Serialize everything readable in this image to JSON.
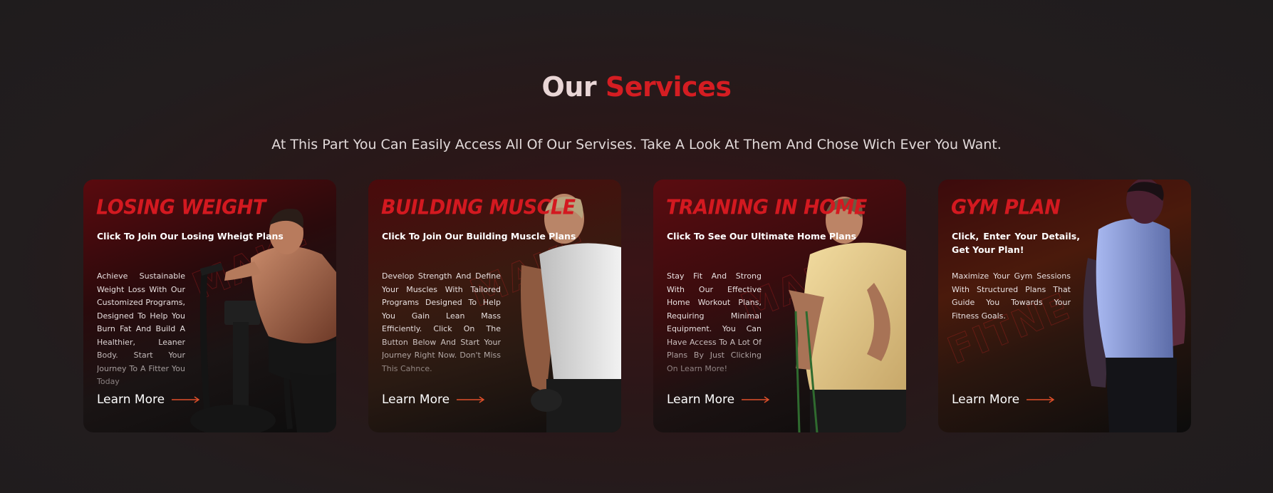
{
  "section": {
    "title_part1": "Our",
    "title_part2": "Services",
    "subtitle": "At This Part You Can Easily Access All Of Our Servises. Take A Look At Them And Chose Wich Ever You Want."
  },
  "cards": [
    {
      "title": "LOSING WEIGHT",
      "cta": "Click To Join Our Losing Wheigt Plans",
      "description": "Achieve Sustainable Weight Loss With Our Customized Programs, Designed To Help You Burn Fat And Build A Healthier, Leaner Body. Start Your Journey To A Fitter You Today",
      "link": "Learn More",
      "image": "man-on-air-bike"
    },
    {
      "title": "BUILDING MUSCLE",
      "cta": "Click To Join Our Building Muscle Plans",
      "description": "Develop Strength And Define Your Muscles With Tailored Programs Designed To Help You Gain Lean Mass Efficiently. Click On The Button Below And Start Your Journey Right Now. Don't Miss This Cahnce.",
      "link": "Learn More",
      "image": "man-in-white-tank-top"
    },
    {
      "title": "TRAINING IN HOME",
      "cta": "Click To See Our Ultimate Home Plans",
      "description": "Stay Fit And Strong With Our Effective Home Workout Plans, Requiring Minimal Equipment. You Can Have Access To A Lot Of Plans By Just Clicking On Learn More!",
      "link": "Learn More",
      "image": "man-with-resistance-band"
    },
    {
      "title": "GYM PLAN",
      "cta": "Click, Enter Your Details, Get Your Plan!",
      "description": "Maximize Your Gym Sessions With Structured Plans That Guide You Towards Your Fitness Goals.",
      "link": "Learn More",
      "image": "man-in-blue-tank-top"
    }
  ],
  "colors": {
    "accent": "#d41d22",
    "background": "#221d1e",
    "text": "#ffffff",
    "arrow": "#e0502a"
  },
  "icons": {
    "learn_more": "arrow-right-icon"
  }
}
